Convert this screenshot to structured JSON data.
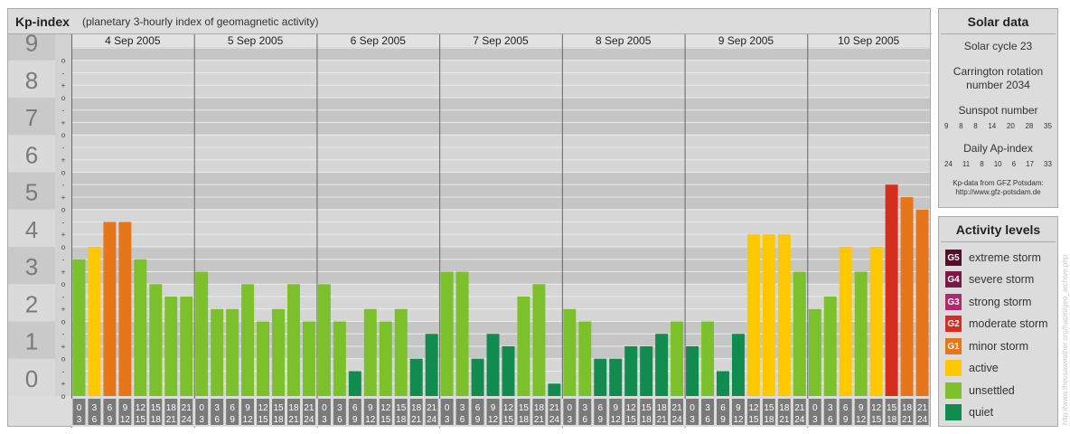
{
  "header": {
    "title": "Kp-index",
    "subtitle": "(planetary 3-hourly index of geomagnetic activity)"
  },
  "chart_data": {
    "type": "bar",
    "title": "Kp-index",
    "subtitle": "(planetary 3-hourly index of geomagnetic activity)",
    "days": [
      "4 Sep 2005",
      "5 Sep 2005",
      "6 Sep 2005",
      "7 Sep 2005",
      "8 Sep 2005",
      "9 Sep 2005",
      "10 Sep 2005"
    ],
    "interval_labels": [
      [
        "0",
        "3"
      ],
      [
        "3",
        "6"
      ],
      [
        "6",
        "9"
      ],
      [
        "9",
        "12"
      ],
      [
        "12",
        "15"
      ],
      [
        "15",
        "18"
      ],
      [
        "18",
        "21"
      ],
      [
        "21",
        "24"
      ]
    ],
    "y_ticks": [
      "0",
      "1",
      "2",
      "3",
      "4",
      "5",
      "6",
      "7",
      "8",
      "9"
    ],
    "y_minor_ticks": [
      "o",
      "+",
      "-"
    ],
    "ylim": [
      0,
      9.333
    ],
    "values": [
      [
        3.667,
        4.0,
        4.667,
        4.667,
        3.667,
        3.0,
        2.667,
        2.667
      ],
      [
        3.333,
        2.333,
        2.333,
        3.0,
        2.0,
        2.333,
        3.0,
        2.0
      ],
      [
        3.0,
        2.0,
        0.667,
        2.333,
        2.0,
        2.333,
        1.0,
        1.667
      ],
      [
        3.333,
        3.333,
        1.0,
        1.667,
        1.333,
        2.667,
        3.0,
        0.333
      ],
      [
        2.333,
        2.0,
        1.0,
        1.0,
        1.333,
        1.333,
        1.667,
        2.0
      ],
      [
        1.333,
        2.0,
        0.667,
        1.667,
        4.333,
        4.333,
        4.333,
        3.333
      ],
      [
        2.333,
        2.667,
        4.0,
        3.333,
        4.0,
        5.667,
        5.333,
        5.0
      ]
    ],
    "color_scale": [
      {
        "min": 0,
        "max": 2,
        "color": "#118c4e",
        "level": "quiet"
      },
      {
        "min": 2,
        "max": 4,
        "color": "#7cc12c",
        "level": "unsettled"
      },
      {
        "min": 4,
        "max": 4.5,
        "color": "#ffc800",
        "level": "active"
      },
      {
        "min": 4.5,
        "max": 5.5,
        "color": "#e7761b",
        "level": "minor storm"
      },
      {
        "min": 5.5,
        "max": 6.5,
        "color": "#d42e1e",
        "level": "moderate storm"
      }
    ],
    "grid": true,
    "legend_position": "right"
  },
  "solar": {
    "title": "Solar data",
    "cycle": "Solar cycle 23",
    "carrington_line1": "Carrington rotation",
    "carrington_line2": "number 2034",
    "sunspot_title": "Sunspot number",
    "sunspot_values": [
      "9",
      "8",
      "8",
      "14",
      "20",
      "28",
      "35"
    ],
    "ap_title": "Daily Ap-index",
    "ap_values": [
      "24",
      "11",
      "8",
      "10",
      "6",
      "17",
      "33"
    ],
    "credit_line1": "Kp-data from GFZ Potsdam:",
    "credit_line2": "http://www.gfz-potsdam.de"
  },
  "activity": {
    "title": "Activity levels",
    "levels": [
      {
        "badge": "G5",
        "label": "extreme storm",
        "color": "#50102a"
      },
      {
        "badge": "G4",
        "label": "severe storm",
        "color": "#7a1848"
      },
      {
        "badge": "G3",
        "label": "strong storm",
        "color": "#b0286e"
      },
      {
        "badge": "G2",
        "label": "moderate storm",
        "color": "#d42e1e"
      },
      {
        "badge": "G1",
        "label": "minor storm",
        "color": "#e7761b"
      },
      {
        "badge": "",
        "label": "active",
        "color": "#ffc800"
      },
      {
        "badge": "",
        "label": "unsettled",
        "color": "#7cc12c"
      },
      {
        "badge": "",
        "label": "quiet",
        "color": "#118c4e"
      }
    ]
  },
  "watermark": "http://www.theusaweather.org/hapiri/geo_archive.php"
}
